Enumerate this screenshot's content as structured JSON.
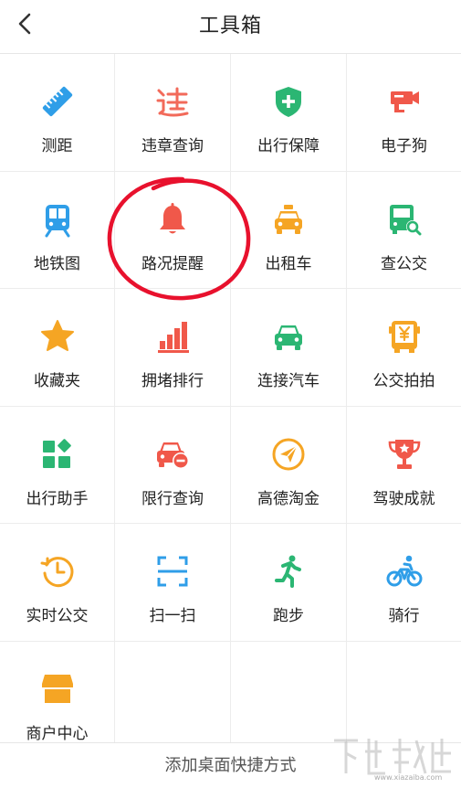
{
  "header": {
    "title": "工具箱",
    "back_icon": "chevron-left-icon"
  },
  "tools": [
    {
      "label": "测距",
      "icon": "ruler-icon",
      "color": "#2f9ee8"
    },
    {
      "label": "违章查询",
      "icon": "violation-icon",
      "color": "#f26a5a"
    },
    {
      "label": "出行保障",
      "icon": "shield-plus-icon",
      "color": "#2bb673"
    },
    {
      "label": "电子狗",
      "icon": "camera-icon",
      "color": "#f0584a"
    },
    {
      "label": "地铁图",
      "icon": "subway-icon",
      "color": "#2f9ee8"
    },
    {
      "label": "路况提醒",
      "icon": "bell-icon",
      "color": "#f0584a"
    },
    {
      "label": "出租车",
      "icon": "taxi-icon",
      "color": "#f5a524"
    },
    {
      "label": "查公交",
      "icon": "bus-search-icon",
      "color": "#2bb673"
    },
    {
      "label": "收藏夹",
      "icon": "star-icon",
      "color": "#f5a524"
    },
    {
      "label": "拥堵排行",
      "icon": "bar-chart-icon",
      "color": "#f0584a"
    },
    {
      "label": "连接汽车",
      "icon": "car-icon",
      "color": "#2bb673"
    },
    {
      "label": "公交拍拍",
      "icon": "bus-yen-icon",
      "color": "#f5a524"
    },
    {
      "label": "出行助手",
      "icon": "apps-icon",
      "color": "#2bb673"
    },
    {
      "label": "限行查询",
      "icon": "car-minus-icon",
      "color": "#f0584a"
    },
    {
      "label": "高德淘金",
      "icon": "paper-plane-icon",
      "color": "#f5a524"
    },
    {
      "label": "驾驶成就",
      "icon": "trophy-icon",
      "color": "#f0584a"
    },
    {
      "label": "实时公交",
      "icon": "clock-icon",
      "color": "#f5a524"
    },
    {
      "label": "扫一扫",
      "icon": "scan-icon",
      "color": "#2f9ee8"
    },
    {
      "label": "跑步",
      "icon": "running-icon",
      "color": "#2bb673"
    },
    {
      "label": "骑行",
      "icon": "bicycle-icon",
      "color": "#2f9ee8"
    },
    {
      "label": "商户中心",
      "icon": "shop-icon",
      "color": "#f5a524"
    }
  ],
  "footer": {
    "label": "添加桌面快捷方式"
  },
  "annotation": {
    "circle_color": "#e8112d"
  },
  "watermark": {
    "url": "www.xiazaiba.com"
  }
}
